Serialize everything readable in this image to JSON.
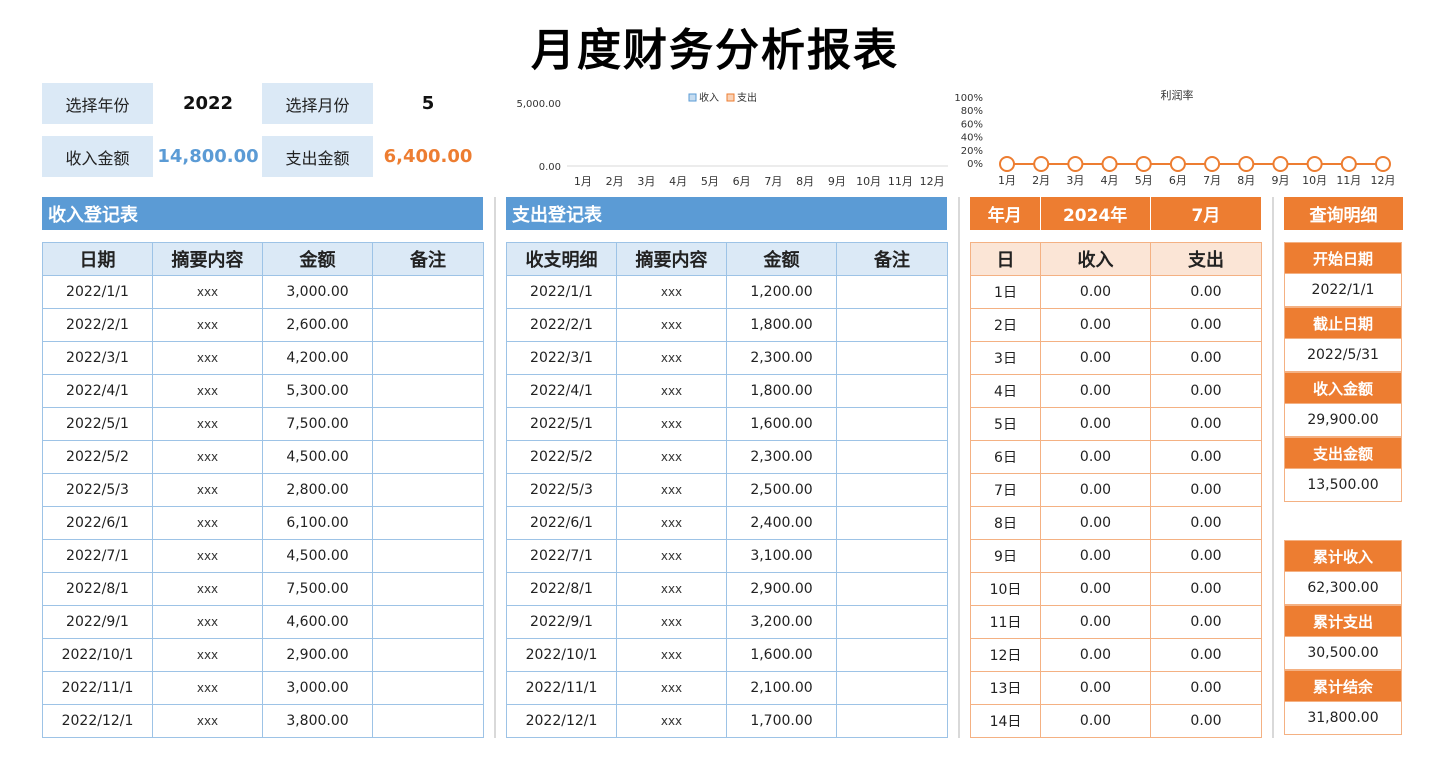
{
  "title": "月度财务分析报表",
  "selectors": {
    "year_label": "选择年份",
    "year_value": "2022",
    "month_label": "选择月份",
    "month_value": "5",
    "income_label": "收入金额",
    "income_value": "14,800.00",
    "expense_label": "支出金额",
    "expense_value": "6,400.00"
  },
  "chart_data": [
    {
      "type": "bar",
      "categories": [
        "1月",
        "2月",
        "3月",
        "4月",
        "5月",
        "6月",
        "7月",
        "8月",
        "9月",
        "10月",
        "11月",
        "12月"
      ],
      "series": [
        {
          "name": "收入",
          "values": [
            0,
            0,
            0,
            0,
            0,
            0,
            0,
            0,
            0,
            0,
            0,
            0
          ],
          "color": "#5b9bd5"
        },
        {
          "name": "支出",
          "values": [
            0,
            0,
            0,
            0,
            0,
            0,
            0,
            0,
            0,
            0,
            0,
            0
          ],
          "color": "#ed7d31"
        }
      ],
      "y_ticks": [
        "5,000.00",
        "0.00"
      ],
      "ylim": [
        0,
        5000
      ],
      "legend": "top"
    },
    {
      "type": "line",
      "title": "利润率",
      "categories": [
        "1月",
        "2月",
        "3月",
        "4月",
        "5月",
        "6月",
        "7月",
        "8月",
        "9月",
        "10月",
        "11月",
        "12月"
      ],
      "series": [
        {
          "values": [
            0,
            0,
            0,
            0,
            0,
            0,
            0,
            0,
            0,
            0,
            0,
            0
          ],
          "color": "#ed7d31"
        }
      ],
      "y_ticks": [
        "100%",
        "80%",
        "60%",
        "40%",
        "20%",
        "0%"
      ],
      "ylim": [
        0,
        1
      ]
    }
  ],
  "income_table": {
    "banner": "收入登记表",
    "headers": [
      "日期",
      "摘要内容",
      "金额",
      "备注"
    ],
    "rows": [
      [
        "2022/1/1",
        "xxx",
        "3,000.00",
        ""
      ],
      [
        "2022/2/1",
        "xxx",
        "2,600.00",
        ""
      ],
      [
        "2022/3/1",
        "xxx",
        "4,200.00",
        ""
      ],
      [
        "2022/4/1",
        "xxx",
        "5,300.00",
        ""
      ],
      [
        "2022/5/1",
        "xxx",
        "7,500.00",
        ""
      ],
      [
        "2022/5/2",
        "xxx",
        "4,500.00",
        ""
      ],
      [
        "2022/5/3",
        "xxx",
        "2,800.00",
        ""
      ],
      [
        "2022/6/1",
        "xxx",
        "6,100.00",
        ""
      ],
      [
        "2022/7/1",
        "xxx",
        "4,500.00",
        ""
      ],
      [
        "2022/8/1",
        "xxx",
        "7,500.00",
        ""
      ],
      [
        "2022/9/1",
        "xxx",
        "4,600.00",
        ""
      ],
      [
        "2022/10/1",
        "xxx",
        "2,900.00",
        ""
      ],
      [
        "2022/11/1",
        "xxx",
        "3,000.00",
        ""
      ],
      [
        "2022/12/1",
        "xxx",
        "3,800.00",
        ""
      ]
    ]
  },
  "expense_table": {
    "banner": "支出登记表",
    "headers": [
      "收支明细",
      "摘要内容",
      "金额",
      "备注"
    ],
    "rows": [
      [
        "2022/1/1",
        "xxx",
        "1,200.00",
        ""
      ],
      [
        "2022/2/1",
        "xxx",
        "1,800.00",
        ""
      ],
      [
        "2022/3/1",
        "xxx",
        "2,300.00",
        ""
      ],
      [
        "2022/4/1",
        "xxx",
        "1,800.00",
        ""
      ],
      [
        "2022/5/1",
        "xxx",
        "1,600.00",
        ""
      ],
      [
        "2022/5/2",
        "xxx",
        "2,300.00",
        ""
      ],
      [
        "2022/5/3",
        "xxx",
        "2,500.00",
        ""
      ],
      [
        "2022/6/1",
        "xxx",
        "2,400.00",
        ""
      ],
      [
        "2022/7/1",
        "xxx",
        "3,100.00",
        ""
      ],
      [
        "2022/8/1",
        "xxx",
        "2,900.00",
        ""
      ],
      [
        "2022/9/1",
        "xxx",
        "3,200.00",
        ""
      ],
      [
        "2022/10/1",
        "xxx",
        "1,600.00",
        ""
      ],
      [
        "2022/11/1",
        "xxx",
        "2,100.00",
        ""
      ],
      [
        "2022/12/1",
        "xxx",
        "1,700.00",
        ""
      ]
    ]
  },
  "daily_table": {
    "header": {
      "label": "年月",
      "year": "2024年",
      "month": "7月"
    },
    "headers": [
      "日",
      "收入",
      "支出"
    ],
    "rows": [
      [
        "1日",
        "0.00",
        "0.00"
      ],
      [
        "2日",
        "0.00",
        "0.00"
      ],
      [
        "3日",
        "0.00",
        "0.00"
      ],
      [
        "4日",
        "0.00",
        "0.00"
      ],
      [
        "5日",
        "0.00",
        "0.00"
      ],
      [
        "6日",
        "0.00",
        "0.00"
      ],
      [
        "7日",
        "0.00",
        "0.00"
      ],
      [
        "8日",
        "0.00",
        "0.00"
      ],
      [
        "9日",
        "0.00",
        "0.00"
      ],
      [
        "10日",
        "0.00",
        "0.00"
      ],
      [
        "11日",
        "0.00",
        "0.00"
      ],
      [
        "12日",
        "0.00",
        "0.00"
      ],
      [
        "13日",
        "0.00",
        "0.00"
      ],
      [
        "14日",
        "0.00",
        "0.00"
      ]
    ]
  },
  "query": {
    "title": "查询明细",
    "start_label": "开始日期",
    "start_value": "2022/1/1",
    "end_label": "截止日期",
    "end_value": "2022/5/31",
    "income_label": "收入金额",
    "income_value": "29,900.00",
    "expense_label": "支出金额",
    "expense_value": "13,500.00",
    "cum_income_label": "累计收入",
    "cum_income_value": "62,300.00",
    "cum_expense_label": "累计支出",
    "cum_expense_value": "30,500.00",
    "cum_balance_label": "累计结余",
    "cum_balance_value": "31,800.00"
  },
  "colors": {
    "blue": "#5b9bd5",
    "light_blue": "#dbe9f6",
    "orange": "#ed7d31",
    "light_orange": "#fbe5d6"
  }
}
